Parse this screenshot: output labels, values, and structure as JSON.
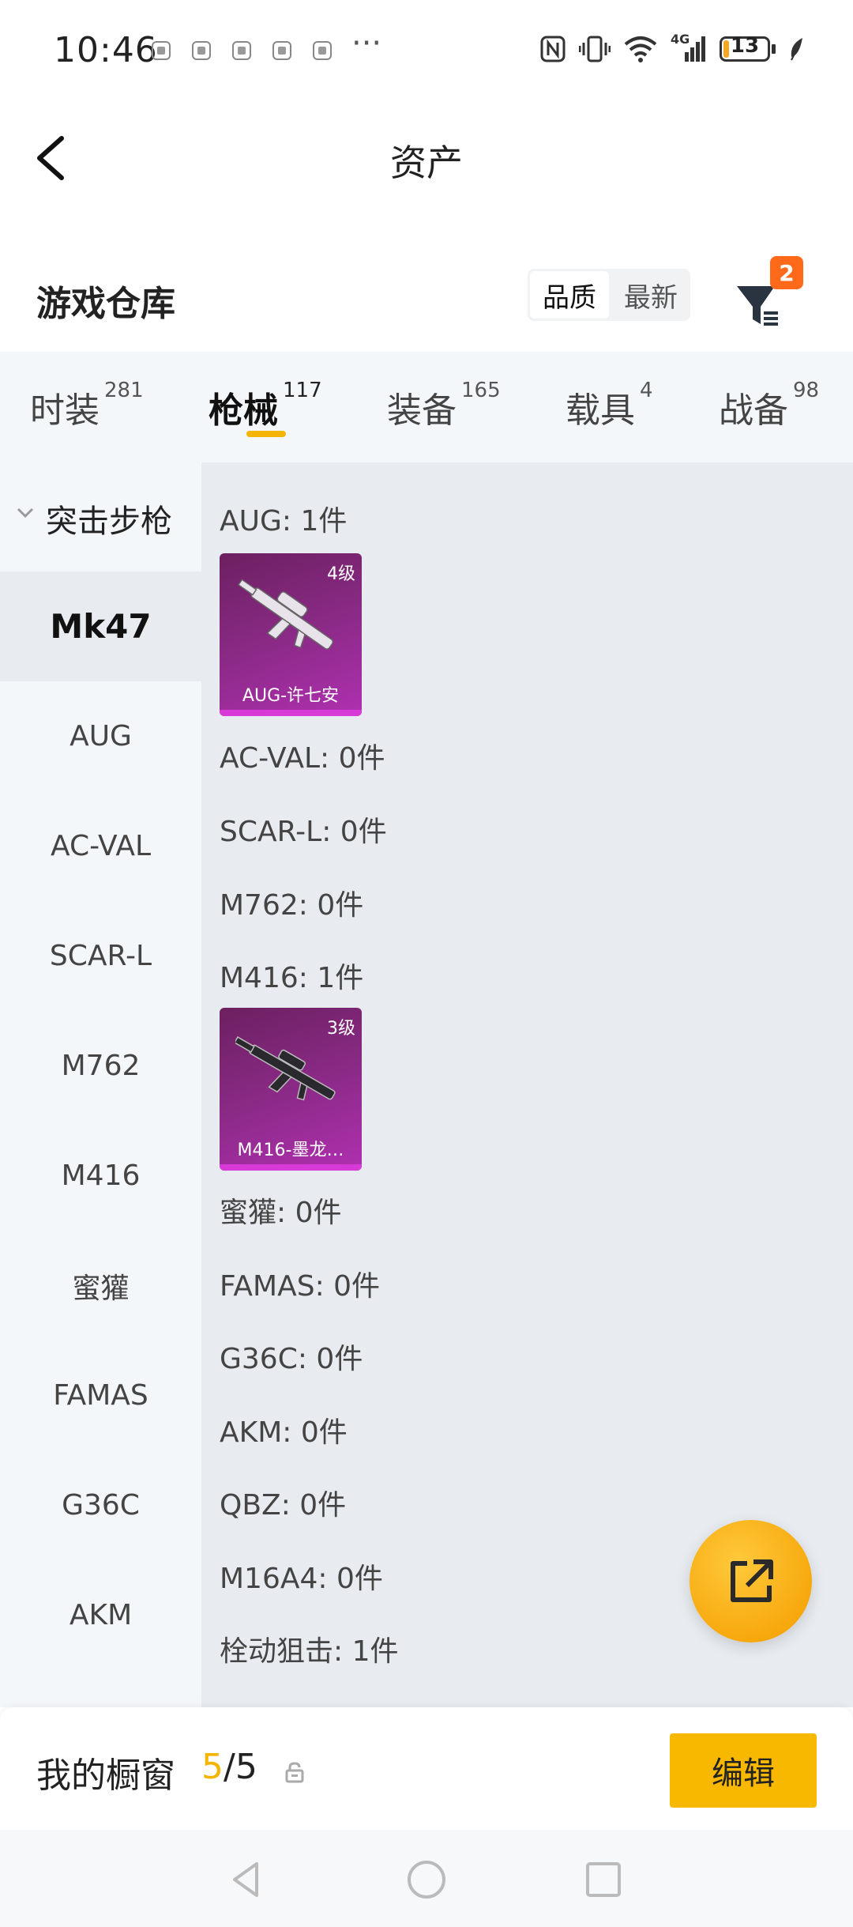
{
  "status_bar": {
    "time": "10:46",
    "more": "···",
    "network": "4G",
    "battery": "13",
    "battery_level": 0.13
  },
  "header": {
    "title": "资产"
  },
  "warehouse": {
    "title": "游戏仓库",
    "sort_options": [
      "品质",
      "最新"
    ],
    "active_sort": "品质",
    "filter_badge": "2"
  },
  "tabs": [
    {
      "label": "时装",
      "count": "281"
    },
    {
      "label": "枪械",
      "count": "117",
      "active": true
    },
    {
      "label": "装备",
      "count": "165"
    },
    {
      "label": "载具",
      "count": "4"
    },
    {
      "label": "战备",
      "count": "98"
    }
  ],
  "sidebar": {
    "group": "突击步枪",
    "items": [
      "Mk47",
      "AUG",
      "AC-VAL",
      "SCAR-L",
      "M762",
      "M416",
      "蜜獾",
      "FAMAS",
      "G36C",
      "AKM"
    ],
    "active": "Mk47"
  },
  "content": {
    "rows": [
      {
        "label": "AUG: 1件"
      },
      {
        "card_name": "AUG-许七安",
        "card_level": "4级"
      },
      {
        "label": "AC-VAL: 0件"
      },
      {
        "label": "SCAR-L: 0件"
      },
      {
        "label": "M762: 0件"
      },
      {
        "label": "M416: 1件"
      },
      {
        "card_name": "M416-墨龙…",
        "card_level": "3级"
      },
      {
        "label": "蜜獾: 0件"
      },
      {
        "label": "FAMAS: 0件"
      },
      {
        "label": "G36C: 0件"
      },
      {
        "label": "AKM: 0件"
      },
      {
        "label": "QBZ: 0件"
      },
      {
        "label": "M16A4: 0件"
      },
      {
        "label": "栓动狙击: 1件"
      }
    ],
    "accent_color": "#f5b400",
    "card_color": "#a02aa0"
  },
  "bottom_bar": {
    "title": "我的橱窗",
    "current": "5",
    "separator_total": "/5",
    "edit_label": "编辑"
  }
}
